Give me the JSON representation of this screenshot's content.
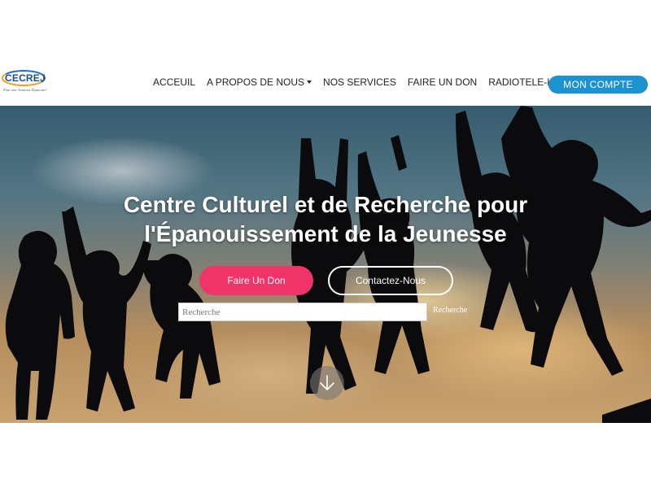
{
  "brand": {
    "logo_text": "CECREJ",
    "tagline": "Pour une Jeunesse Épanouie!"
  },
  "nav": {
    "items": [
      "ACCEUIL",
      "A PROPOS DE NOUS",
      "NOS SERVICES",
      "FAIRE UN DON",
      "RADIOTELE-LIVE"
    ],
    "account_button": "MON COMPTE"
  },
  "hero": {
    "title_line1": "Centre Culturel et de Recherche pour",
    "title_line2": "l'Épanouissement de la Jeunesse",
    "donate_button": "Faire Un Don",
    "contact_button": "Contactez-Nous",
    "search_placeholder": "Recherche",
    "search_button": "Recherche"
  },
  "icons": {
    "dropdown": "caret-down-icon",
    "scroll": "arrow-down-icon"
  },
  "colors": {
    "accent_blue": "#1c93d0",
    "donate_pink": "#f0346a",
    "logo_blue": "#1b4f8c",
    "logo_orange": "#f0a020"
  }
}
